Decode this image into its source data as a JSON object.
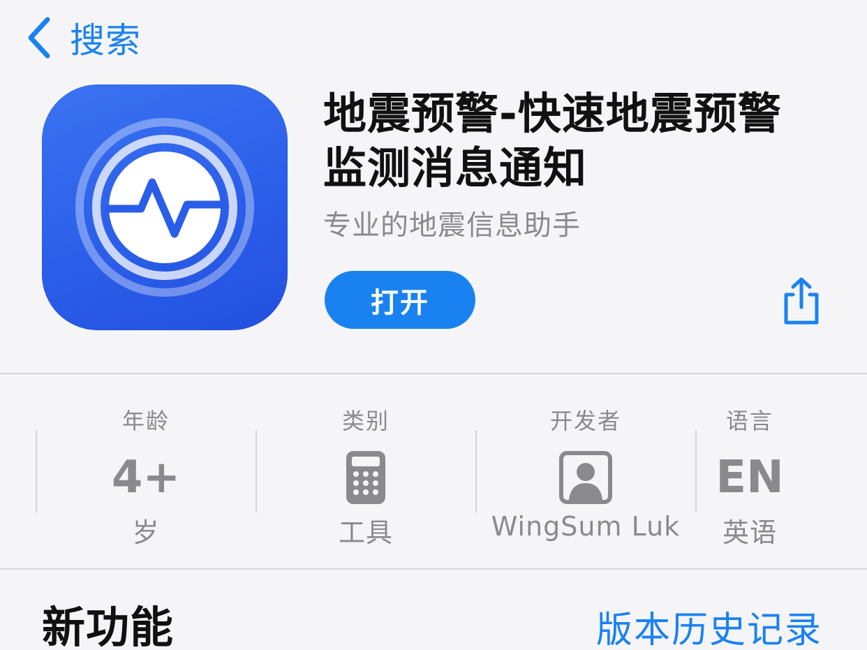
{
  "nav": {
    "back_label": "搜索"
  },
  "app": {
    "title_line1": "地震预警-快速地震预警",
    "title_line2": "监测消息通知",
    "subtitle": "专业的地震信息助手",
    "open_label": "打开"
  },
  "info": {
    "age": {
      "label": "年龄",
      "value": "4+",
      "sub": "岁"
    },
    "category": {
      "label": "类别",
      "icon": "calculator-icon",
      "sub": "工具"
    },
    "developer": {
      "label": "开发者",
      "icon": "person-square-icon",
      "sub": "WingSum Luk"
    },
    "language": {
      "label": "语言",
      "value": "EN",
      "sub": "英语"
    }
  },
  "whats_new": {
    "title": "新功能",
    "history_link": "版本历史记录"
  },
  "colors": {
    "accent": "#1a82f0",
    "icon_blue": "#2a5de8",
    "secondary_text": "#8a8a8e"
  }
}
